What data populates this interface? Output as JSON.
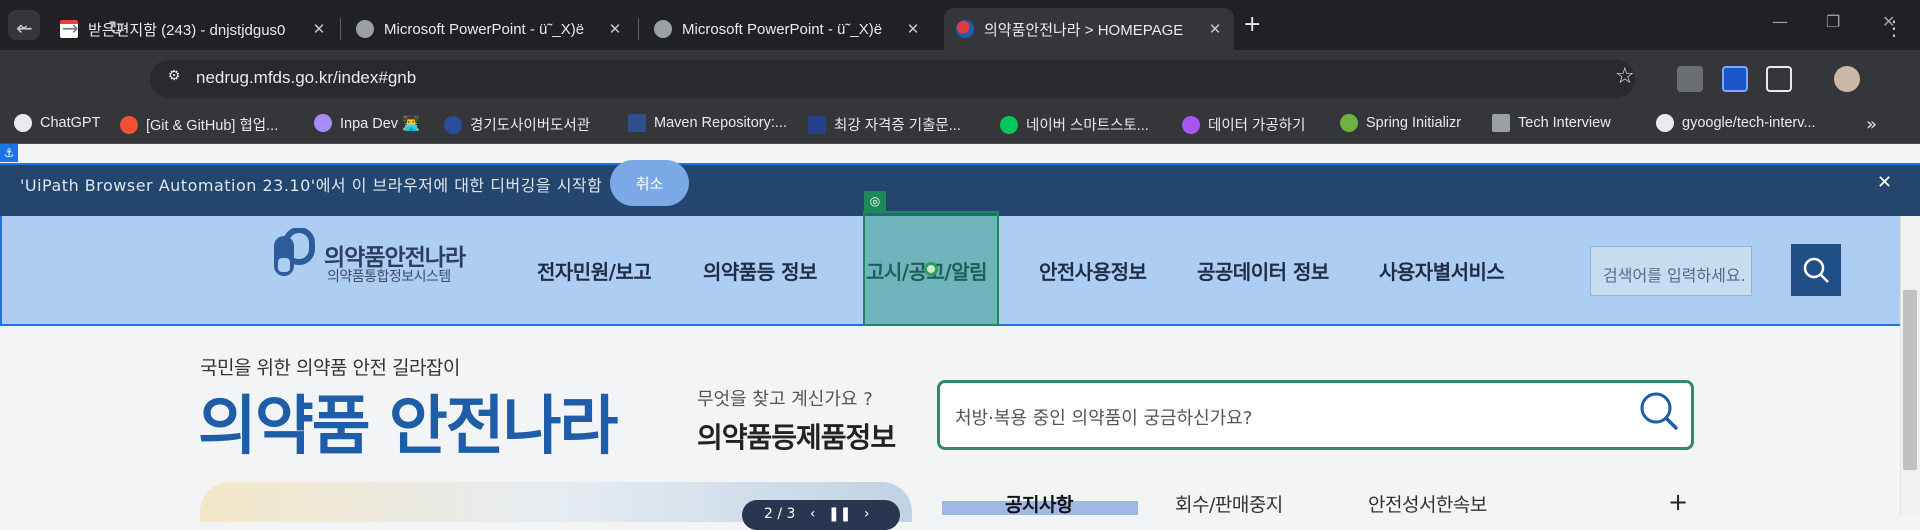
{
  "browser": {
    "tabs": [
      {
        "title": "받은편지함 (243) - dnjstjdgus0",
        "icon": "gmail-icon",
        "active": false
      },
      {
        "title": "Microsoft PowerPoint - ü˜_X)ё",
        "icon": "globe-icon",
        "active": false
      },
      {
        "title": "Microsoft PowerPoint - ü˜_X)ё",
        "icon": "globe-icon",
        "active": false
      },
      {
        "title": "의약품안전나라 > HOMEPAGE",
        "icon": "mfds-icon",
        "active": true
      }
    ],
    "url": "nedrug.mfds.go.kr/index#gnb",
    "bookmarks": [
      {
        "label": "ChatGPT",
        "icon": "chatgpt-icon"
      },
      {
        "label": "[Git & GitHub] 협업...",
        "icon": "git-icon"
      },
      {
        "label": "Inpa Dev 👨‍💻",
        "icon": "inpa-icon"
      },
      {
        "label": "경기도사이버도서관",
        "icon": "library-icon"
      },
      {
        "label": "Maven Repository:...",
        "icon": "maven-icon"
      },
      {
        "label": "최강 자격증 기출문...",
        "icon": "gsc-icon"
      },
      {
        "label": "네이버 스마트스토...",
        "icon": "naver-icon"
      },
      {
        "label": "데이터 가공하기",
        "icon": "heart-icon"
      },
      {
        "label": "Spring Initializr",
        "icon": "spring-icon"
      },
      {
        "label": "Tech Interview",
        "icon": "tech-icon"
      },
      {
        "label": "gyoogle/tech-interv...",
        "icon": "github-icon"
      }
    ]
  },
  "debug_bar": {
    "message": "'UiPath Browser Automation 23.10'에서 이 브라우저에 대한 디버깅을 시작함",
    "cancel_label": "취소"
  },
  "site": {
    "logo_title": "의약품안전나라",
    "logo_subtitle": "의약품통합정보시스템",
    "gnb": [
      "전자민원/보고",
      "의약품등 정보",
      "고시/공고/알림",
      "안전사용정보",
      "공공데이터 정보",
      "사용자별서비스"
    ],
    "header_search_placeholder": "검색어를 입력하세요.",
    "slogan": "국민을 위한 의약품 안전 길라잡이",
    "big_title": "의약품 안전나라",
    "question": "무엇을 찾고 계신가요 ?",
    "question_title": "의약품등제품정보",
    "main_search_placeholder": "처방·복용 중인 의약품이 궁금하신가요?",
    "banner_counter": "2 / 3",
    "news_tabs": [
      "공지사항",
      "회수/판매중지",
      "안전성서한속보"
    ],
    "news_more": "+"
  },
  "colors": {
    "brand_blue": "#1e5ea8",
    "search_border": "#2f8a6a",
    "highlight": "#1e8a5c"
  }
}
